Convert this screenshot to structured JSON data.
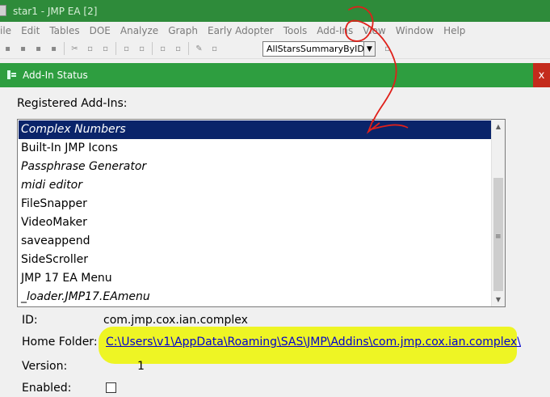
{
  "main_window": {
    "title": "star1 - JMP EA [2]",
    "menu": [
      "ile",
      "Edit",
      "Tables",
      "DOE",
      "Analyze",
      "Graph",
      "Early Adopter",
      "Tools",
      "Add-Ins",
      "View",
      "Window",
      "Help"
    ],
    "toolbar_combo_value": "AllStarsSummaryByID"
  },
  "dialog": {
    "title": "Add-In Status",
    "close_label": "x",
    "registered_label": "Registered Add-Ins:",
    "addins": [
      {
        "name": "Complex Numbers",
        "italic": true,
        "selected": true
      },
      {
        "name": "Built-In JMP Icons",
        "italic": false,
        "selected": false
      },
      {
        "name": "Passphrase Generator",
        "italic": true,
        "selected": false
      },
      {
        "name": "midi editor",
        "italic": true,
        "selected": false
      },
      {
        "name": "FileSnapper",
        "italic": false,
        "selected": false
      },
      {
        "name": "VideoMaker",
        "italic": false,
        "selected": false
      },
      {
        "name": "saveappend",
        "italic": false,
        "selected": false
      },
      {
        "name": "SideScroller",
        "italic": false,
        "selected": false
      },
      {
        "name": "JMP 17 EA Menu",
        "italic": false,
        "selected": false
      },
      {
        "name": "_loader.JMP17.EAmenu",
        "italic": true,
        "selected": false
      }
    ],
    "details": {
      "id_label": "ID:",
      "id_value": "com.jmp.cox.ian.complex",
      "home_label": "Home Folder:",
      "home_value": "C:\\Users\\v1\\AppData\\Roaming\\SAS\\JMP\\Addins\\com.jmp.cox.ian.complex\\",
      "version_label": "Version:",
      "version_value": "1",
      "enabled_label": "Enabled:"
    }
  },
  "colors": {
    "title_green": "#2e9e40",
    "selection": "#0a246a",
    "highlight": "#eef524",
    "annotation": "#e0201a"
  }
}
